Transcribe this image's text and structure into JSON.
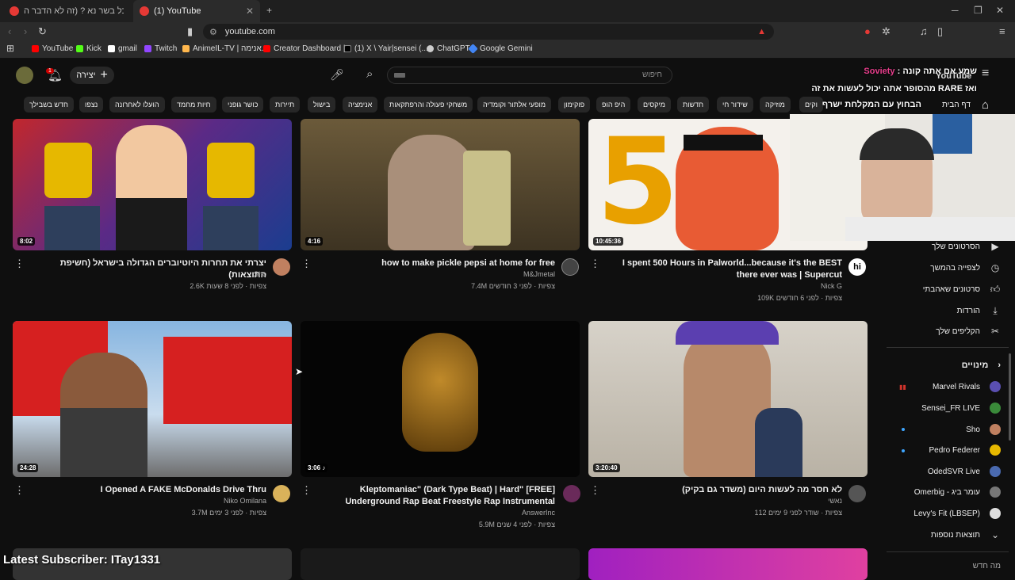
{
  "browser": {
    "tabs": [
      {
        "title": "רונן אוכל בשר נא ? (זה לא הדבר ה"
      },
      {
        "title": "(1) YouTube"
      }
    ],
    "new_tab": "+",
    "url": "youtube.com",
    "bookmarks": [
      {
        "label": "YouTube",
        "color": "#ff0000"
      },
      {
        "label": "Kick",
        "color": "#53fc18"
      },
      {
        "label": "gmail",
        "color": "#ffffff"
      },
      {
        "label": "Twitch",
        "color": "#9146ff"
      },
      {
        "label": "AnimeIL-TV | אנימה...",
        "color": "#ffb74d"
      },
      {
        "label": "Creator Dashboard |...",
        "color": "#ff0000"
      },
      {
        "label": "(1) X \\ Yair|sensei (...",
        "color": "#000000"
      },
      {
        "label": "ChatGPT",
        "color": "#cccccc"
      },
      {
        "label": "Google Gemini",
        "color": "#4285f4"
      }
    ]
  },
  "youtube": {
    "notifications_count": "1",
    "create_label": "יצירה",
    "search_placeholder": "חיפוש",
    "logo": "YouTube",
    "chips": [
      "דף הבית",
      "מוזיקה",
      "שידור חי",
      "חדשות",
      "מיקסים",
      "היפ הופ",
      "פוקימון",
      "מופעי אלתור וקומדיה",
      "משחקי פעולה והרפתקאות",
      "אנימציה",
      "בישול",
      "תיירות",
      "כושר גופני",
      "חיות מחמד",
      "הועלו לאחרונה",
      "נצפו",
      "חדש בשבילך"
    ],
    "chip_partial": "וקים",
    "videos": [
      {
        "title": "יצרתי את תחרות היוטיוברים הגדולה בישראל (חשיפת התוצאות)",
        "channel": "Sho",
        "meta": "2.6K צפיות · לפני 8 שעות",
        "duration": "8:02"
      },
      {
        "title": "how to make pickle  pepsi at home  for free",
        "channel": "M&Jmetal",
        "meta": "7.4M צפיות · לפני 3 חודשים",
        "duration": "4:16"
      },
      {
        "title": "I spent 500 Hours in Palworld...because it's the BEST there ever was | Supercut",
        "channel": "Nick G",
        "meta": "109K צפיות · לפני 6 חודשים",
        "duration": "10:45:36",
        "avatar_text": "hi"
      },
      {
        "title": "I Opened A FAKE McDonalds Drive Thru",
        "channel": "Niko Omilana",
        "meta": "3.7M צפיות · לפני 3 ימים",
        "duration": "24:28"
      },
      {
        "title": "[FREE] \"Kleptomaniac\" (Dark Type Beat) | Hard Underground Rap Beat Freestyle Rap Instrumental",
        "channel": "AnswerInc",
        "meta": "5.9M צפיות · לפני 4 שנים",
        "duration": "3:06 ♪"
      },
      {
        "title": "לא חסר מה לעשות היום (משדר גם בקיק)",
        "channel": "נאשי",
        "meta": "112 צפיות · שודר לפני 9 ימים",
        "duration": "3:20:40"
      }
    ],
    "sidebar": {
      "items": [
        "הסרטונים שלך",
        "לצפייה בהמשך",
        "סרטונים שאהבתי",
        "הורדות",
        "הקליפים שלך"
      ],
      "subs_header": "מינויים",
      "subs": [
        "Marvel Rivals",
        "Sensei_FR LIVE",
        "Sho",
        "Pedro Federer",
        "OdedSVR Live",
        "Omerbig - עומר ביג",
        "Levy's Fit (LBSEP)"
      ],
      "show_more": "תוצאות נוספות",
      "bottom_partial": "מה חדש"
    }
  },
  "stream_overlay": {
    "line1_a": "שמע אם אתה קונה :",
    "line1_b": "Soviety",
    "line2": "ואז RARE מהסופר אתה יכול לעשות את זה",
    "line3": "הבחוץ עם המקלחת ישרף",
    "latest_subscriber": "Latest Subscriber: ITay1331"
  },
  "colors": {
    "accent_red": "#ff0000",
    "live_blue": "#3ea6ff",
    "bg": "#0f0f0f",
    "chip_bg": "#272727"
  }
}
